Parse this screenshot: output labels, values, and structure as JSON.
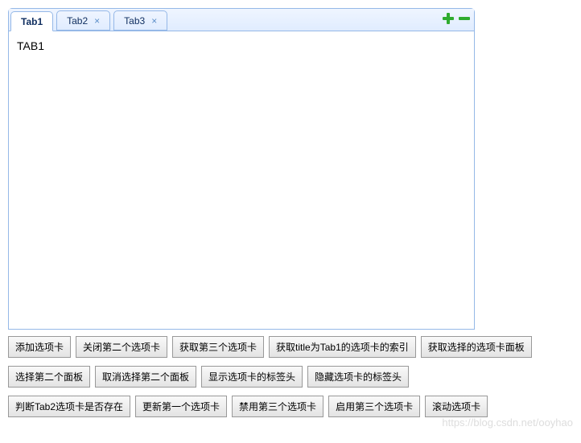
{
  "tabs": {
    "items": [
      {
        "label": "Tab1",
        "closable": false,
        "active": true
      },
      {
        "label": "Tab2",
        "closable": true,
        "active": false
      },
      {
        "label": "Tab3",
        "closable": true,
        "active": false
      }
    ],
    "body_content": "TAB1",
    "tools": {
      "add_icon": "plus-icon",
      "remove_icon": "minus-icon",
      "add_color": "#2FAB2F",
      "remove_color": "#2FAB2F"
    }
  },
  "buttons": {
    "row1": [
      "添加选项卡",
      "关闭第二个选项卡",
      "获取第三个选项卡",
      "获取title为Tab1的选项卡的索引",
      "获取选择的选项卡面板"
    ],
    "row2": [
      "选择第二个面板",
      "取消选择第二个面板",
      "显示选项卡的标签头",
      "隐藏选项卡的标签头"
    ],
    "row3": [
      "判断Tab2选项卡是否存在",
      "更新第一个选项卡",
      "禁用第三个选项卡",
      "启用第三个选项卡",
      "滚动选项卡"
    ]
  },
  "watermark": "https://blog.csdn.net/ooyhao"
}
